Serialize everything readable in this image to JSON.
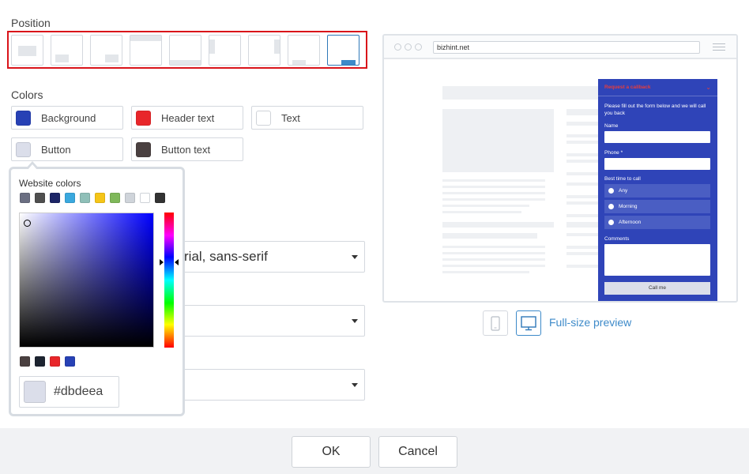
{
  "position": {
    "label": "Position",
    "tiles": [
      {
        "name": "center"
      },
      {
        "name": "bottom-left"
      },
      {
        "name": "bottom-right"
      },
      {
        "name": "top-bar"
      },
      {
        "name": "bottom-bar"
      },
      {
        "name": "left-side"
      },
      {
        "name": "right-side"
      },
      {
        "name": "bottom-left-small"
      },
      {
        "name": "bottom-right-tab",
        "selected": true
      }
    ]
  },
  "colors": {
    "label": "Colors",
    "background": {
      "label": "Background",
      "color": "#2741b5"
    },
    "header_text": {
      "label": "Header text",
      "color": "#e8262a"
    },
    "text": {
      "label": "Text",
      "color": "#ffffff"
    },
    "button": {
      "label": "Button",
      "color": "#dbdeea"
    },
    "button_text": {
      "label": "Button text",
      "color": "#4a4040"
    }
  },
  "font": {
    "value": "rial, sans-serif"
  },
  "picker": {
    "title": "Website colors",
    "website_colors": [
      "#6b6f82",
      "#4f4f4f",
      "#1c2566",
      "#3aa8de",
      "#8fbfb8",
      "#f5c518",
      "#7fb85a",
      "#cfd4da",
      "#ffffff",
      "#333333"
    ],
    "recent_colors": [
      "#4a4040",
      "#1d2430",
      "#e8262a",
      "#2741b5"
    ],
    "hex": "#dbdeea"
  },
  "preview": {
    "url": "bizhint.net",
    "widget": {
      "title": "Request a callback",
      "intro": "Please fill out the form below and we will call you back",
      "name_label": "Name",
      "phone_label": "Phone *",
      "best_time_label": "Best time to call",
      "options": [
        "Any",
        "Morning",
        "Afternoon"
      ],
      "comments_label": "Comments",
      "submit": "Call me"
    },
    "full_size_label": "Full-size preview"
  },
  "footer": {
    "ok": "OK",
    "cancel": "Cancel"
  }
}
